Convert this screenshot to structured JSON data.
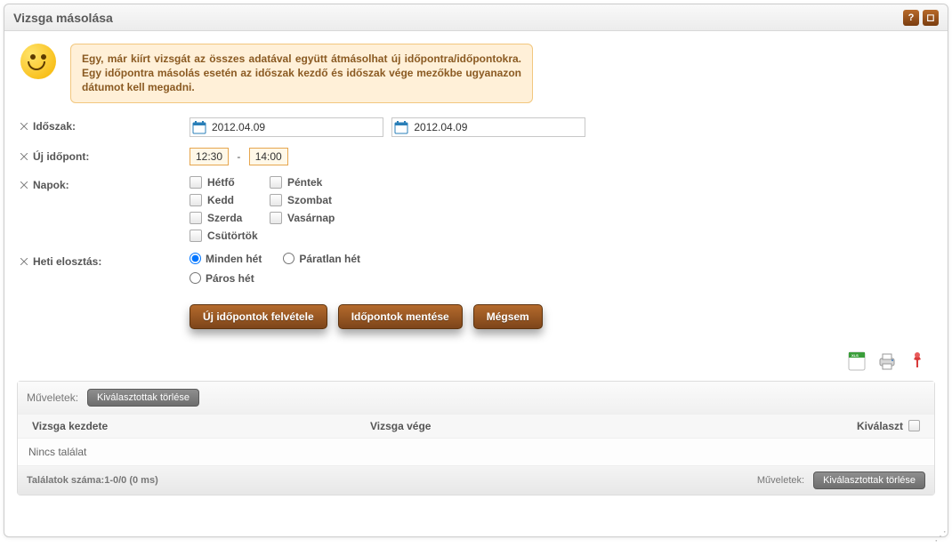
{
  "title": "Vizsga másolása",
  "hint": "Egy, már kiírt vizsgát az összes adatával együtt átmásolhat új időpontra/időpontokra. Egy időpontra másolás esetén az időszak kezdő és időszak vége mezőkbe ugyanazon dátumot kell megadni.",
  "labels": {
    "period": "Időszak:",
    "newtime": "Új időpont:",
    "days": "Napok:",
    "weekdist": "Heti elosztás:"
  },
  "period": {
    "start": "2012.04.09",
    "end": "2012.04.09"
  },
  "newtime": {
    "from": "12:30",
    "sep": "-",
    "to": "14:00"
  },
  "days": {
    "mon": "Hétfő",
    "tue": "Kedd",
    "wed": "Szerda",
    "thu": "Csütörtök",
    "fri": "Péntek",
    "sat": "Szombat",
    "sun": "Vasárnap"
  },
  "weekdist": {
    "every": "Minden hét",
    "odd": "Páratlan hét",
    "even": "Páros hét"
  },
  "buttons": {
    "add": "Új időpontok felvétele",
    "save": "Időpontok mentése",
    "cancel": "Mégsem"
  },
  "grid": {
    "ops_label": "Műveletek:",
    "delete_selected": "Kiválasztottak törlése",
    "col_start": "Vizsga kezdete",
    "col_end": "Vizsga vége",
    "col_select": "Kiválaszt",
    "empty": "Nincs találat",
    "footer_count": "Találatok száma:1-0/0 (0 ms)"
  },
  "titlebar_icons": {
    "help": "?",
    "close": "◻"
  }
}
